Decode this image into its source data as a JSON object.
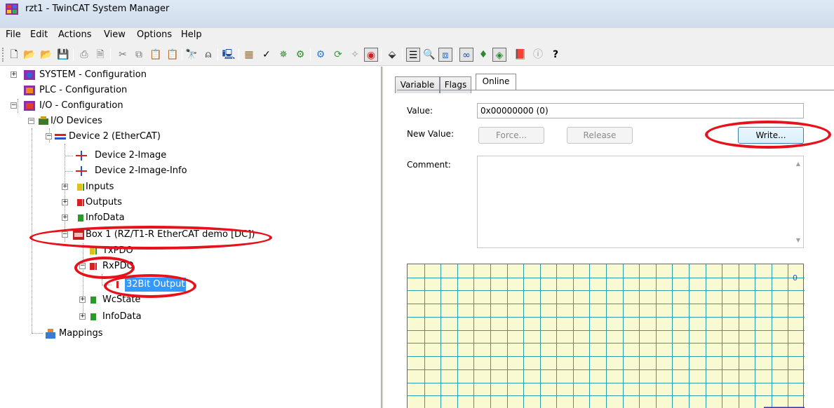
{
  "window": {
    "title": "rzt1 - TwinCAT System Manager"
  },
  "menu": [
    "File",
    "Edit",
    "Actions",
    "View",
    "Options",
    "Help"
  ],
  "toolbar": {
    "buttons": [
      "new-icon",
      "open-icon",
      "open-folder-icon",
      "save-icon",
      "print-icon",
      "print-preview-icon",
      "cut-icon",
      "copy-icon",
      "paste-icon",
      "paste-with-links-icon",
      "find-icon",
      "find-next-icon",
      "remote-connection-icon",
      "generate-mappings-icon",
      "check-configuration-icon",
      "activate-configuration-icon",
      "restart-twincat-icon",
      "restart-config-mode-icon",
      "reload-devices-icon",
      "scan-icon",
      "toggle-free-run-icon",
      "show-online-data-icon",
      "display-table-icon",
      "zoom-icon",
      "show-sub-items-icon",
      "watch-icon",
      "auto-link-icon",
      "show-target-icon",
      "help-book-icon",
      "info-icon",
      "help-icon"
    ]
  },
  "tree": {
    "items": [
      {
        "label": "SYSTEM - Configuration",
        "icon": "system-config-icon"
      },
      {
        "label": "PLC - Configuration",
        "icon": "plc-config-icon"
      },
      {
        "label": "I/O - Configuration",
        "icon": "io-config-icon"
      },
      {
        "label": "I/O Devices",
        "icon": "io-devices-icon"
      },
      {
        "label": "Device 2 (EtherCAT)",
        "icon": "ethercat-device-icon"
      },
      {
        "label": "Device 2-Image",
        "icon": "image-icon"
      },
      {
        "label": "Device 2-Image-Info",
        "icon": "image-info-icon"
      },
      {
        "label": "Inputs",
        "icon": "inputs-icon"
      },
      {
        "label": "Outputs",
        "icon": "outputs-icon"
      },
      {
        "label": "InfoData",
        "icon": "infodata-icon"
      },
      {
        "label": "Box 1 (RZ/T1-R EtherCAT demo [DC])",
        "icon": "box-icon"
      },
      {
        "label": "TxPDO",
        "icon": "txpdo-icon"
      },
      {
        "label": "RxPDO",
        "icon": "rxpdo-icon"
      },
      {
        "label": "32Bit Output",
        "icon": "output-variable-icon"
      },
      {
        "label": "WcState",
        "icon": "wcstate-icon"
      },
      {
        "label": "InfoData",
        "icon": "infodata-icon"
      },
      {
        "label": "Mappings",
        "icon": "mappings-icon"
      }
    ]
  },
  "tabs": [
    "Variable",
    "Flags",
    "Online"
  ],
  "online": {
    "value_label": "Value:",
    "value": "0x00000000 (0)",
    "new_value_label": "New Value:",
    "force_label": "Force...",
    "release_label": "Release",
    "write_label": "Write...",
    "comment_label": "Comment:",
    "chart_value_label": "0"
  },
  "colors": {
    "highlight_oval": "#e8101a",
    "selection": "#3399ff",
    "chart_bg": "#fafad2",
    "chart_grid": "#2aa1a8",
    "chart_line": "#3030c8"
  }
}
